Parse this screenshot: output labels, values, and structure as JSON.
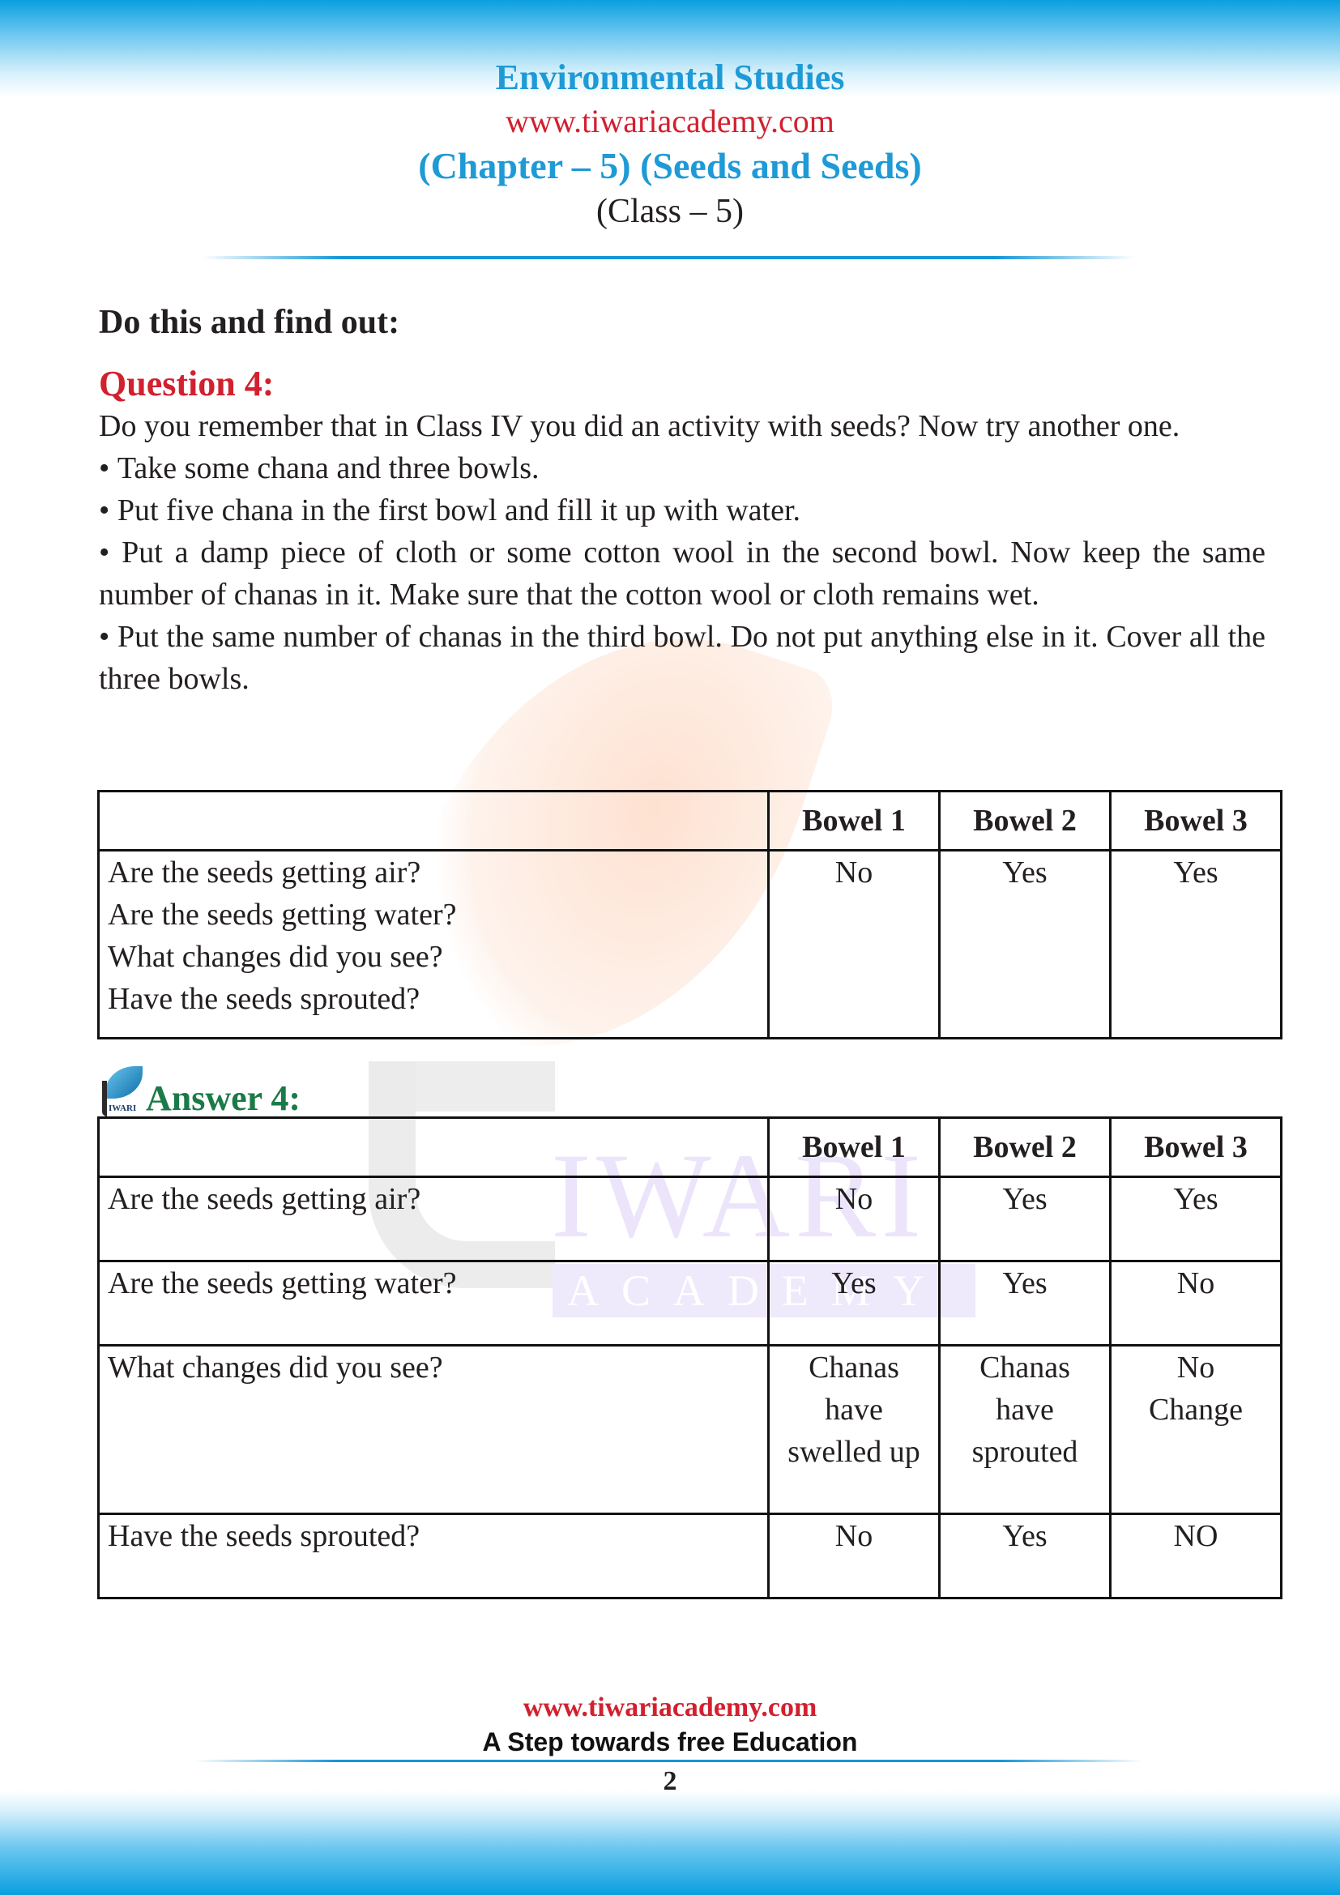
{
  "header": {
    "subject": "Environmental Studies",
    "website": "www.tiwariacademy.com",
    "chapter": "(Chapter – 5) (Seeds and Seeds)",
    "class": "(Class – 5)"
  },
  "section_heading": "Do this and find out:",
  "question": {
    "title": "Question 4:",
    "intro": "Do you remember that in Class IV you did an activity with seeds? Now try another one.",
    "bullets": [
      "Take some chana and three bowls.",
      "Put five chana in the first bowl and fill it up with water.",
      "Put a damp piece of cloth or some cotton wool in the second bowl. Now keep the same number of chanas in it. Make sure that the cotton wool or cloth remains wet.",
      "Put the same number of chanas in the third bowl. Do not put anything else in it. Cover all the three bowls."
    ],
    "table": {
      "headers": [
        "",
        "Bowel 1",
        "Bowel 2",
        "Bowel 3"
      ],
      "questions": [
        "Are the seeds getting air?",
        "Are the seeds getting water?",
        "What changes did you see?",
        "Have the seeds sprouted?"
      ],
      "values": [
        "No",
        "Yes",
        "Yes"
      ]
    }
  },
  "answer": {
    "title": "Answer 4:",
    "logo_text": "IWARI",
    "table": {
      "headers": [
        "",
        "Bowel 1",
        "Bowel 2",
        "Bowel 3"
      ],
      "rows": [
        {
          "question": "Are the seeds getting air?",
          "cells": [
            [
              "No"
            ],
            [
              "Yes"
            ],
            [
              "Yes"
            ]
          ]
        },
        {
          "question": "Are the seeds getting water?",
          "cells": [
            [
              "Yes"
            ],
            [
              "Yes"
            ],
            [
              "No"
            ]
          ]
        },
        {
          "question": "What changes did you see?",
          "cells": [
            [
              "Chanas",
              "have",
              "swelled up"
            ],
            [
              "Chanas",
              "have",
              "sprouted"
            ],
            [
              "No",
              "Change"
            ]
          ]
        },
        {
          "question": "Have the seeds sprouted?",
          "cells": [
            [
              "No"
            ],
            [
              "Yes"
            ],
            [
              "NO"
            ]
          ]
        }
      ]
    }
  },
  "watermark": {
    "word1": "IWARI",
    "word2": "ACADEMY"
  },
  "footer": {
    "website": "www.tiwariacademy.com",
    "slogan": "A Step towards free Education",
    "page_number": "2"
  }
}
